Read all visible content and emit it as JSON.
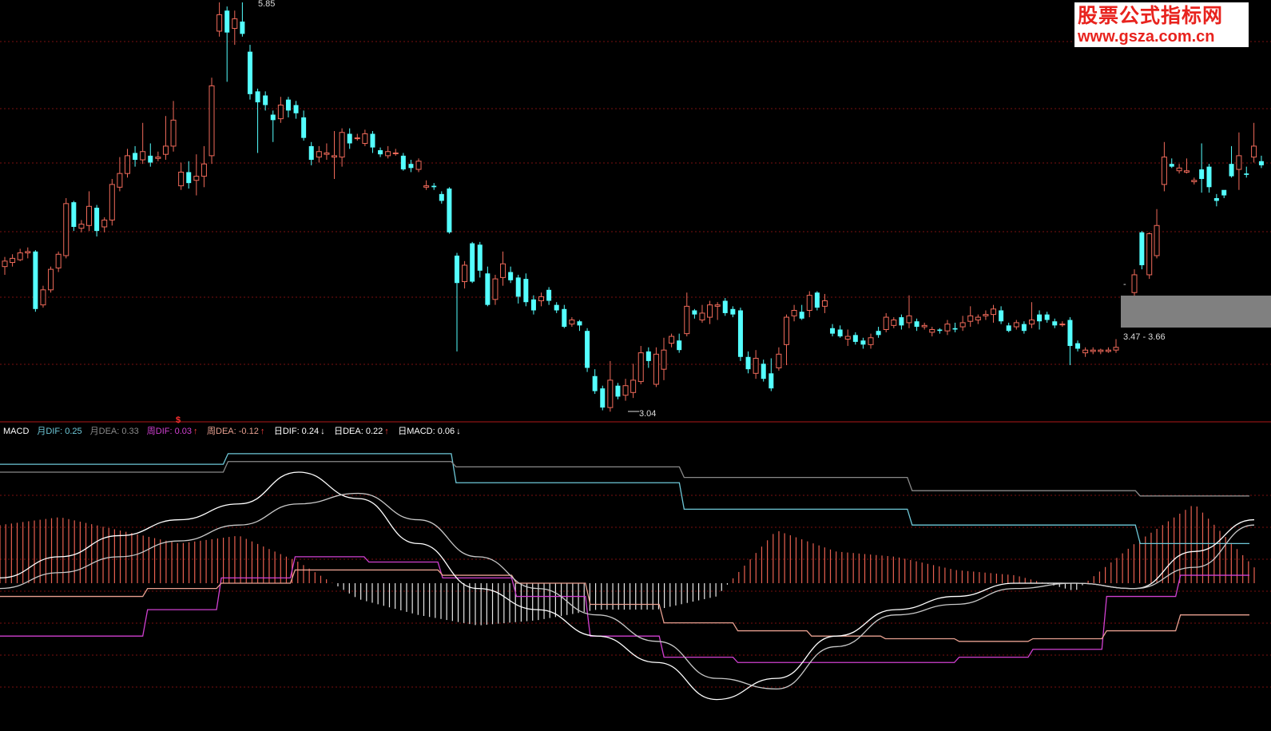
{
  "watermark": {
    "title": "股票公式指标网",
    "url": "www.gsza.com.cn"
  },
  "price_labels": {
    "high": "5.85",
    "low": "3.04",
    "range": "3.47 - 3.66",
    "dash": "-"
  },
  "indicator_header": [
    {
      "text": "MACD",
      "color": "#ffffff",
      "arrow": ""
    },
    {
      "text": "月DIF: 0.25",
      "color": "#6ec8d8",
      "arrow": ""
    },
    {
      "text": "月DEA: 0.33",
      "color": "#8a8a8a",
      "arrow": ""
    },
    {
      "text": "周DIF: 0.03",
      "color": "#d040d0",
      "arrow": "↑"
    },
    {
      "text": "周DEA: -0.12",
      "color": "#e8a090",
      "arrow": "↑"
    },
    {
      "text": "日DIF: 0.24",
      "color": "#ffffff",
      "arrow": "↓"
    },
    {
      "text": "日DEA: 0.22",
      "color": "#ffffff",
      "arrow": "↑"
    },
    {
      "text": "日MACD: 0.06",
      "color": "#ffffff",
      "arrow": "↓"
    }
  ],
  "signal_marker": "$",
  "colors": {
    "up": "#f06a5a",
    "down": "#54ffff",
    "grid": "#7a1010",
    "white_line": "#ffffff",
    "month_dif": "#6ec8d8",
    "month_dea": "#8a8a8a",
    "week_dif": "#d040d0",
    "week_dea": "#e8a090",
    "grey_box": "#808080"
  },
  "chart_data": {
    "type": "candlestick",
    "price_high": 5.85,
    "price_low": 3.04,
    "candles": [
      [
        3.92,
        3.96,
        3.86,
        3.99
      ],
      [
        3.95,
        3.98,
        3.92,
        4.01
      ],
      [
        3.97,
        4.02,
        3.96,
        4.05
      ],
      [
        4.02,
        4.03,
        3.98,
        4.06
      ],
      [
        4.03,
        3.61,
        3.59,
        4.04
      ],
      [
        3.64,
        3.75,
        3.62,
        3.78
      ],
      [
        3.75,
        3.9,
        3.73,
        3.92
      ],
      [
        3.91,
        4.01,
        3.88,
        4.03
      ],
      [
        4.0,
        4.38,
        3.98,
        4.42
      ],
      [
        4.39,
        4.21,
        4.18,
        4.4
      ],
      [
        4.2,
        4.23,
        4.17,
        4.26
      ],
      [
        4.22,
        4.36,
        4.18,
        4.47
      ],
      [
        4.35,
        4.18,
        4.14,
        4.37
      ],
      [
        4.21,
        4.26,
        4.17,
        4.28
      ],
      [
        4.26,
        4.52,
        4.22,
        4.56
      ],
      [
        4.5,
        4.6,
        4.47,
        4.72
      ],
      [
        4.6,
        4.73,
        4.57,
        4.78
      ],
      [
        4.75,
        4.7,
        4.65,
        4.8
      ],
      [
        4.7,
        4.76,
        4.67,
        4.97
      ],
      [
        4.73,
        4.68,
        4.65,
        4.82
      ],
      [
        4.71,
        4.72,
        4.69,
        4.76
      ],
      [
        4.74,
        4.8,
        4.7,
        5.02
      ],
      [
        4.8,
        4.99,
        4.76,
        5.13
      ],
      [
        4.51,
        4.61,
        4.48,
        4.68
      ],
      [
        4.61,
        4.53,
        4.49,
        4.69
      ],
      [
        4.55,
        4.58,
        4.44,
        4.74
      ],
      [
        4.58,
        4.67,
        4.5,
        4.8
      ],
      [
        4.73,
        5.24,
        4.67,
        5.3
      ],
      [
        5.64,
        5.76,
        5.6,
        5.85
      ],
      [
        5.79,
        5.63,
        5.27,
        5.82
      ],
      [
        5.66,
        5.73,
        5.54,
        5.79
      ],
      [
        5.71,
        5.62,
        5.6,
        5.85
      ],
      [
        5.49,
        5.18,
        5.14,
        5.54
      ],
      [
        5.2,
        5.12,
        4.75,
        5.22
      ],
      [
        5.17,
        5.1,
        5.06,
        5.2
      ],
      [
        5.03,
        4.99,
        4.83,
        5.06
      ],
      [
        5.0,
        5.1,
        4.97,
        5.16
      ],
      [
        5.14,
        5.06,
        5.01,
        5.16
      ],
      [
        5.1,
        5.04,
        5.0,
        5.13
      ],
      [
        5.01,
        4.86,
        4.84,
        5.06
      ],
      [
        4.8,
        4.7,
        4.66,
        4.83
      ],
      [
        4.72,
        4.76,
        4.68,
        4.8
      ],
      [
        4.74,
        4.75,
        4.7,
        4.82
      ],
      [
        4.72,
        4.73,
        4.56,
        4.91
      ],
      [
        4.72,
        4.9,
        4.65,
        4.93
      ],
      [
        4.89,
        4.82,
        4.78,
        4.93
      ],
      [
        4.86,
        4.86,
        4.84,
        4.89
      ],
      [
        4.82,
        4.89,
        4.8,
        4.92
      ],
      [
        4.89,
        4.79,
        4.75,
        4.91
      ],
      [
        4.77,
        4.74,
        4.72,
        4.79
      ],
      [
        4.73,
        4.76,
        4.71,
        4.8
      ],
      [
        4.75,
        4.75,
        4.73,
        4.78
      ],
      [
        4.73,
        4.63,
        4.62,
        4.75
      ],
      [
        4.67,
        4.64,
        4.61,
        4.7
      ],
      [
        4.63,
        4.69,
        4.61,
        4.71
      ],
      [
        4.5,
        4.51,
        4.48,
        4.55
      ],
      [
        4.51,
        4.5,
        4.48,
        4.53
      ],
      [
        4.45,
        4.4,
        4.38,
        4.47
      ],
      [
        4.49,
        4.17,
        4.16,
        4.5
      ],
      [
        4.0,
        3.8,
        3.3,
        4.02
      ],
      [
        3.81,
        3.93,
        3.76,
        3.96
      ],
      [
        4.09,
        3.81,
        3.8,
        4.1
      ],
      [
        4.08,
        3.89,
        3.84,
        4.1
      ],
      [
        3.87,
        3.64,
        3.63,
        3.92
      ],
      [
        3.68,
        3.83,
        3.64,
        3.86
      ],
      [
        3.84,
        3.94,
        3.78,
        4.03
      ],
      [
        3.88,
        3.82,
        3.8,
        3.92
      ],
      [
        3.84,
        3.7,
        3.65,
        3.86
      ],
      [
        3.83,
        3.66,
        3.63,
        3.87
      ],
      [
        3.68,
        3.6,
        3.57,
        3.71
      ],
      [
        3.67,
        3.7,
        3.63,
        3.73
      ],
      [
        3.75,
        3.67,
        3.64,
        3.77
      ],
      [
        3.64,
        3.6,
        3.58,
        3.66
      ],
      [
        3.61,
        3.48,
        3.47,
        3.64
      ],
      [
        3.5,
        3.53,
        3.48,
        3.55
      ],
      [
        3.52,
        3.49,
        3.45,
        3.53
      ],
      [
        3.45,
        3.18,
        3.15,
        3.47
      ],
      [
        3.12,
        3.01,
        2.99,
        3.17
      ],
      [
        3.03,
        2.89,
        2.87,
        3.05
      ],
      [
        2.89,
        3.09,
        2.86,
        3.23
      ],
      [
        3.05,
        2.97,
        2.95,
        3.07
      ],
      [
        2.98,
        3.05,
        2.94,
        3.1
      ],
      [
        3.0,
        3.09,
        2.96,
        3.21
      ],
      [
        3.08,
        3.29,
        3.06,
        3.34
      ],
      [
        3.3,
        3.23,
        3.18,
        3.33
      ],
      [
        3.06,
        3.28,
        3.04,
        3.33
      ],
      [
        3.17,
        3.31,
        3.09,
        3.4
      ],
      [
        3.36,
        3.41,
        3.33,
        3.43
      ],
      [
        3.38,
        3.31,
        3.29,
        3.43
      ],
      [
        3.43,
        3.63,
        3.41,
        3.73
      ],
      [
        3.6,
        3.57,
        3.54,
        3.61
      ],
      [
        3.53,
        3.58,
        3.51,
        3.64
      ],
      [
        3.55,
        3.64,
        3.5,
        3.67
      ],
      [
        3.63,
        3.64,
        3.53,
        3.66
      ],
      [
        3.67,
        3.58,
        3.56,
        3.69
      ],
      [
        3.61,
        3.57,
        3.55,
        3.63
      ],
      [
        3.6,
        3.26,
        3.23,
        3.62
      ],
      [
        3.26,
        3.17,
        3.14,
        3.3
      ],
      [
        3.14,
        3.25,
        3.1,
        3.31
      ],
      [
        3.21,
        3.1,
        3.08,
        3.24
      ],
      [
        3.14,
        3.03,
        3.01,
        3.25
      ],
      [
        3.18,
        3.28,
        3.16,
        3.33
      ],
      [
        3.35,
        3.55,
        3.2,
        3.57
      ],
      [
        3.56,
        3.6,
        3.52,
        3.64
      ],
      [
        3.59,
        3.54,
        3.53,
        3.64
      ],
      [
        3.6,
        3.71,
        3.55,
        3.74
      ],
      [
        3.73,
        3.62,
        3.6,
        3.74
      ],
      [
        3.63,
        3.67,
        3.58,
        3.72
      ],
      [
        3.47,
        3.43,
        3.41,
        3.5
      ],
      [
        3.46,
        3.41,
        3.4,
        3.49
      ],
      [
        3.39,
        3.41,
        3.34,
        3.46
      ],
      [
        3.42,
        3.37,
        3.35,
        3.44
      ],
      [
        3.38,
        3.35,
        3.32,
        3.4
      ],
      [
        3.35,
        3.4,
        3.32,
        3.43
      ],
      [
        3.45,
        3.42,
        3.4,
        3.48
      ],
      [
        3.46,
        3.55,
        3.44,
        3.58
      ],
      [
        3.49,
        3.53,
        3.47,
        3.55
      ],
      [
        3.55,
        3.49,
        3.46,
        3.57
      ],
      [
        3.51,
        3.56,
        3.47,
        3.71
      ],
      [
        3.52,
        3.48,
        3.45,
        3.54
      ],
      [
        3.48,
        3.49,
        3.46,
        3.51
      ],
      [
        3.44,
        3.46,
        3.41,
        3.48
      ],
      [
        3.46,
        3.45,
        3.43,
        3.47
      ],
      [
        3.45,
        3.5,
        3.42,
        3.53
      ],
      [
        3.47,
        3.46,
        3.44,
        3.51
      ],
      [
        3.48,
        3.51,
        3.45,
        3.56
      ],
      [
        3.52,
        3.56,
        3.48,
        3.63
      ],
      [
        3.53,
        3.55,
        3.5,
        3.57
      ],
      [
        3.56,
        3.57,
        3.53,
        3.6
      ],
      [
        3.57,
        3.61,
        3.51,
        3.64
      ],
      [
        3.6,
        3.52,
        3.5,
        3.63
      ],
      [
        3.49,
        3.45,
        3.44,
        3.51
      ],
      [
        3.48,
        3.51,
        3.46,
        3.53
      ],
      [
        3.5,
        3.45,
        3.43,
        3.52
      ],
      [
        3.5,
        3.53,
        3.47,
        3.66
      ],
      [
        3.57,
        3.52,
        3.46,
        3.6
      ],
      [
        3.57,
        3.53,
        3.51,
        3.59
      ],
      [
        3.52,
        3.49,
        3.47,
        3.54
      ],
      [
        3.5,
        3.5,
        3.48,
        3.52
      ],
      [
        3.53,
        3.34,
        3.2,
        3.55
      ],
      [
        3.36,
        3.32,
        3.3,
        3.38
      ],
      [
        3.29,
        3.31,
        3.26,
        3.33
      ],
      [
        3.3,
        3.31,
        3.28,
        3.33
      ],
      [
        3.3,
        3.31,
        3.28,
        3.32
      ],
      [
        3.3,
        3.31,
        3.29,
        3.33
      ],
      [
        3.31,
        3.33,
        3.29,
        3.39
      ],
      [
        3.73,
        3.86,
        3.62,
        3.9
      ],
      [
        4.17,
        3.93,
        3.9,
        4.18
      ],
      [
        3.86,
        4.16,
        3.83,
        4.17
      ],
      [
        4.0,
        4.22,
        3.98,
        4.34
      ],
      [
        4.52,
        4.72,
        4.47,
        4.83
      ],
      [
        4.67,
        4.65,
        4.64,
        4.71
      ],
      [
        4.62,
        4.64,
        4.6,
        4.67
      ],
      [
        4.61,
        4.62,
        4.6,
        4.71
      ],
      [
        4.54,
        4.55,
        4.52,
        4.57
      ],
      [
        4.63,
        4.56,
        4.46,
        4.82
      ],
      [
        4.65,
        4.5,
        4.46,
        4.67
      ],
      [
        4.42,
        4.4,
        4.36,
        4.45
      ],
      [
        4.48,
        4.44,
        4.42,
        4.46
      ],
      [
        4.67,
        4.58,
        4.57,
        4.8
      ],
      [
        4.63,
        4.73,
        4.48,
        4.9
      ],
      [
        4.6,
        4.59,
        4.57,
        4.65
      ],
      [
        4.72,
        4.8,
        4.68,
        4.97
      ],
      [
        4.69,
        4.66,
        4.64,
        4.73
      ]
    ],
    "panel2": {
      "series": [
        {
          "name": "月DIF",
          "values": [
            0.45,
            0.45,
            0.49,
            0.49,
            0.38,
            0.38,
            0.28,
            0.28,
            0.22,
            0.22,
            0.15
          ]
        },
        {
          "name": "月DEA",
          "values": [
            0.42,
            0.42,
            0.46,
            0.46,
            0.44,
            0.44,
            0.4,
            0.4,
            0.35,
            0.35,
            0.33
          ]
        },
        {
          "name": "周DIF",
          "values": [
            -0.2,
            -0.2,
            -0.1,
            0.02,
            0.1,
            0.08,
            0.02,
            -0.05,
            -0.2,
            -0.28,
            -0.3,
            -0.3,
            -0.3,
            -0.28,
            -0.25,
            -0.05,
            0.03
          ]
        },
        {
          "name": "周DEA",
          "values": [
            -0.05,
            -0.05,
            -0.02,
            0.0,
            0.05,
            0.05,
            0.03,
            0.0,
            -0.08,
            -0.15,
            -0.18,
            -0.2,
            -0.21,
            -0.22,
            -0.21,
            -0.18,
            -0.12
          ]
        },
        {
          "name": "日DIF",
          "values": [
            0.02,
            0.1,
            0.18,
            0.24,
            0.3,
            0.42,
            0.32,
            0.15,
            -0.02,
            -0.1,
            -0.2,
            -0.3,
            -0.44,
            -0.36,
            -0.2,
            -0.1,
            -0.05,
            0.0,
            0.0,
            -0.02,
            0.12,
            0.24
          ]
        },
        {
          "name": "日DEA",
          "values": [
            -0.02,
            0.04,
            0.1,
            0.16,
            0.22,
            0.3,
            0.34,
            0.24,
            0.1,
            -0.02,
            -0.12,
            -0.22,
            -0.36,
            -0.4,
            -0.24,
            -0.12,
            -0.08,
            -0.02,
            0.0,
            -0.02,
            0.06,
            0.22
          ]
        },
        {
          "name": "日MACD",
          "values": [
            0.22,
            0.25,
            0.2,
            0.15,
            0.18,
            0.08,
            -0.06,
            -0.12,
            -0.16,
            -0.14,
            -0.1,
            -0.1,
            -0.05,
            0.2,
            0.12,
            0.1,
            0.05,
            0.03,
            -0.03,
            0.15,
            0.3,
            0.06
          ]
        }
      ]
    }
  }
}
